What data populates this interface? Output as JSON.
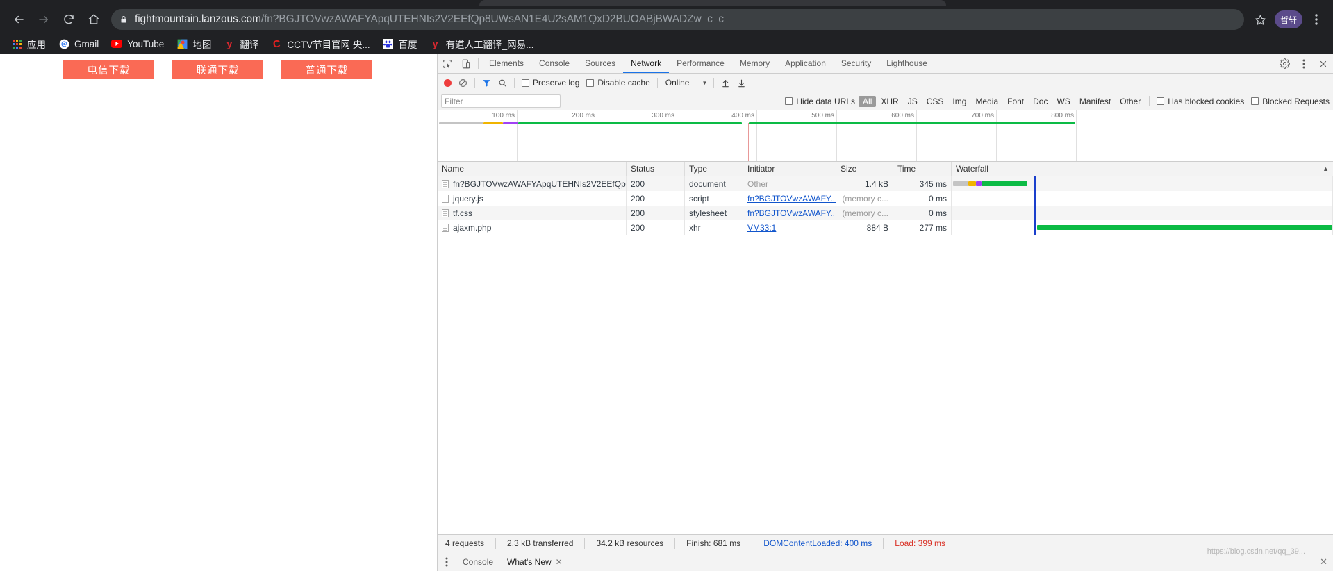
{
  "browser": {
    "nav": {
      "back": "back-arrow",
      "forward": "forward-arrow",
      "reload": "reload",
      "home": "home"
    },
    "omnibox": {
      "lock_icon": "lock-icon",
      "host": "fightmountain.lanzous.com",
      "path": "/fn?BGJTOVwzAWAFYApqUTEHNIs2V2EEfQp8UWsAN1E4U2sAM1QxD2BUOABjBWADZw_c_c",
      "star_icon": "star-icon",
      "profile_label": "哲轩",
      "menu_icon": "kebab-menu-icon"
    },
    "bookmarks": [
      {
        "label": "应用",
        "icon": "apps-grid-icon",
        "color": "#4285f4"
      },
      {
        "label": "Gmail",
        "icon": "gmail-icon",
        "color": "#ea4335"
      },
      {
        "label": "YouTube",
        "icon": "youtube-icon",
        "color": "#ff0000"
      },
      {
        "label": "地图",
        "icon": "google-maps-icon",
        "color": "#34a853"
      },
      {
        "label": "翻译",
        "icon": "youdao-y-icon",
        "color": "#d7282f"
      },
      {
        "label": "CCTV节目官网 央...",
        "icon": "cctv-c-icon",
        "color": "#e02020"
      },
      {
        "label": "百度",
        "icon": "baidu-paw-icon",
        "color": "#2932e1"
      },
      {
        "label": "有道人工翻译_网易...",
        "icon": "youdao-y-icon",
        "color": "#d7282f"
      }
    ]
  },
  "page": {
    "download_buttons": [
      {
        "label": "电信下载"
      },
      {
        "label": "联通下载"
      },
      {
        "label": "普通下载"
      }
    ],
    "button_color": "#fa6a55"
  },
  "devtools": {
    "tools": {
      "inspect_icon": "inspect-element-icon",
      "device_icon": "toggle-device-toolbar-icon",
      "settings_icon": "gear-icon",
      "more_icon": "kebab-menu-icon",
      "close_icon": "close-icon"
    },
    "tabs": [
      {
        "label": "Elements",
        "active": false
      },
      {
        "label": "Console",
        "active": false
      },
      {
        "label": "Sources",
        "active": false
      },
      {
        "label": "Network",
        "active": true
      },
      {
        "label": "Performance",
        "active": false
      },
      {
        "label": "Memory",
        "active": false
      },
      {
        "label": "Application",
        "active": false
      },
      {
        "label": "Security",
        "active": false
      },
      {
        "label": "Lighthouse",
        "active": false
      }
    ],
    "toolbar": {
      "record_icon": "record-stop-icon",
      "clear_icon": "clear-icon",
      "filter_icon": "filter-funnel-icon",
      "search_icon": "search-icon",
      "preserve_log": "Preserve log",
      "disable_cache": "Disable cache",
      "throttle_value": "Online",
      "import_icon": "import-har-icon",
      "export_icon": "export-har-icon"
    },
    "filterbar": {
      "filter_placeholder": "Filter",
      "hide_data_urls": "Hide data URLs",
      "types": [
        {
          "label": "All",
          "active": true
        },
        {
          "label": "XHR",
          "active": false
        },
        {
          "label": "JS",
          "active": false
        },
        {
          "label": "CSS",
          "active": false
        },
        {
          "label": "Img",
          "active": false
        },
        {
          "label": "Media",
          "active": false
        },
        {
          "label": "Font",
          "active": false
        },
        {
          "label": "Doc",
          "active": false
        },
        {
          "label": "WS",
          "active": false
        },
        {
          "label": "Manifest",
          "active": false
        },
        {
          "label": "Other",
          "active": false
        }
      ],
      "has_blocked_cookies": "Has blocked cookies",
      "blocked_requests": "Blocked Requests"
    },
    "overview": {
      "ticks": [
        "100 ms",
        "200 ms",
        "300 ms",
        "400 ms",
        "500 ms",
        "600 ms",
        "700 ms",
        "800 ms"
      ]
    },
    "grid": {
      "columns": [
        "Name",
        "Status",
        "Type",
        "Initiator",
        "Size",
        "Time",
        "Waterfall"
      ],
      "sort_icon": "sort-ascending-icon",
      "rows": [
        {
          "name": "fn?BGJTOVwzAWAFYApqUTEHNIs2V2EEfQp...",
          "status": "200",
          "type": "document",
          "initiator": "Other",
          "initiator_link": false,
          "size": "1.4 kB",
          "time": "345 ms"
        },
        {
          "name": "jquery.js",
          "status": "200",
          "type": "script",
          "initiator": "fn?BGJTOVwzAWAFY...",
          "initiator_link": true,
          "size": "(memory c...",
          "time": "0 ms"
        },
        {
          "name": "tf.css",
          "status": "200",
          "type": "stylesheet",
          "initiator": "fn?BGJTOVwzAWAFY...",
          "initiator_link": true,
          "size": "(memory c...",
          "time": "0 ms"
        },
        {
          "name": "ajaxm.php",
          "status": "200",
          "type": "xhr",
          "initiator": "VM33:1",
          "initiator_link": true,
          "size": "884 B",
          "time": "277 ms"
        }
      ]
    },
    "status": {
      "requests": "4 requests",
      "transferred": "2.3 kB transferred",
      "resources": "34.2 kB resources",
      "finish": "Finish: 681 ms",
      "dom_content_loaded": "DOMContentLoaded: 400 ms",
      "load": "Load: 399 ms"
    },
    "drawer": {
      "more_icon": "kebab-menu-icon",
      "tabs": [
        {
          "label": "Console",
          "active": false
        },
        {
          "label": "What's New",
          "active": true
        }
      ],
      "close_icon": "close-icon"
    }
  },
  "watermark": "https://blog.csdn.net/qq_39..."
}
